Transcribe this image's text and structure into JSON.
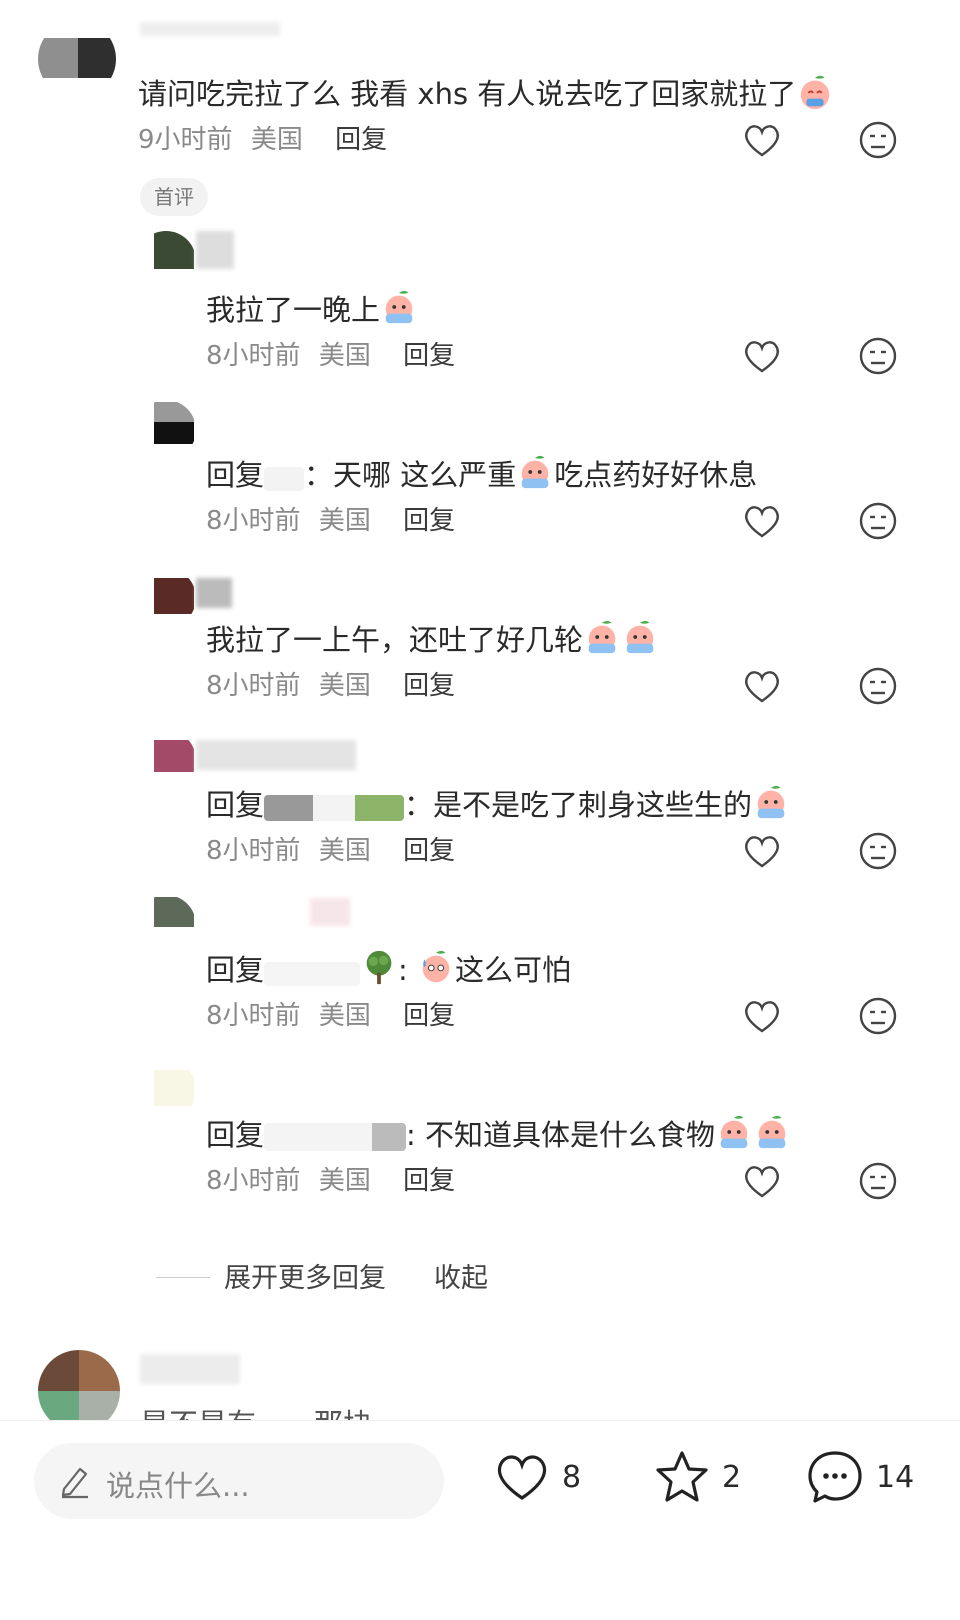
{
  "first_comment": {
    "text": "请问吃完拉了么 我看 xhs 有人说去吃了回家就拉了",
    "time": "9小时前",
    "location": "美国",
    "reply_label": "回复",
    "tag": "首评"
  },
  "replies": [
    {
      "prefix": "",
      "text": "我拉了一晚上",
      "time": "8小时前",
      "location": "美国",
      "reply_label": "回复"
    },
    {
      "prefix": "回复",
      "text": "：天哪 这么严重",
      "text2": "吃点药好好休息",
      "time": "8小时前",
      "location": "美国",
      "reply_label": "回复"
    },
    {
      "prefix": "",
      "text": "我拉了一上午，还吐了好几轮",
      "time": "8小时前",
      "location": "美国",
      "reply_label": "回复"
    },
    {
      "prefix": "回复",
      "text": "：是不是吃了刺身这些生的",
      "time": "8小时前",
      "location": "美国",
      "reply_label": "回复"
    },
    {
      "prefix": "回复",
      "text": ": ",
      "text2": "这么可怕",
      "time": "8小时前",
      "location": "美国",
      "reply_label": "回复"
    },
    {
      "prefix": "回复",
      "text": ": 不知道具体是什么食物",
      "time": "8小时前",
      "location": "美国",
      "reply_label": "回复"
    }
  ],
  "expand_more": "展开更多回复",
  "collapse": "收起",
  "next_comment_partial": "是不是有……那块",
  "bottom_bar": {
    "input_placeholder": "说点什么...",
    "like_count": "8",
    "star_count": "2",
    "comment_count": "14"
  },
  "icons": [
    "heart-outline-icon",
    "meh-face-icon",
    "pencil-icon",
    "heart-icon",
    "star-icon",
    "comment-bubble-icon",
    "crying-peach-emoji",
    "tree-emoji",
    "sweat-emoji"
  ]
}
